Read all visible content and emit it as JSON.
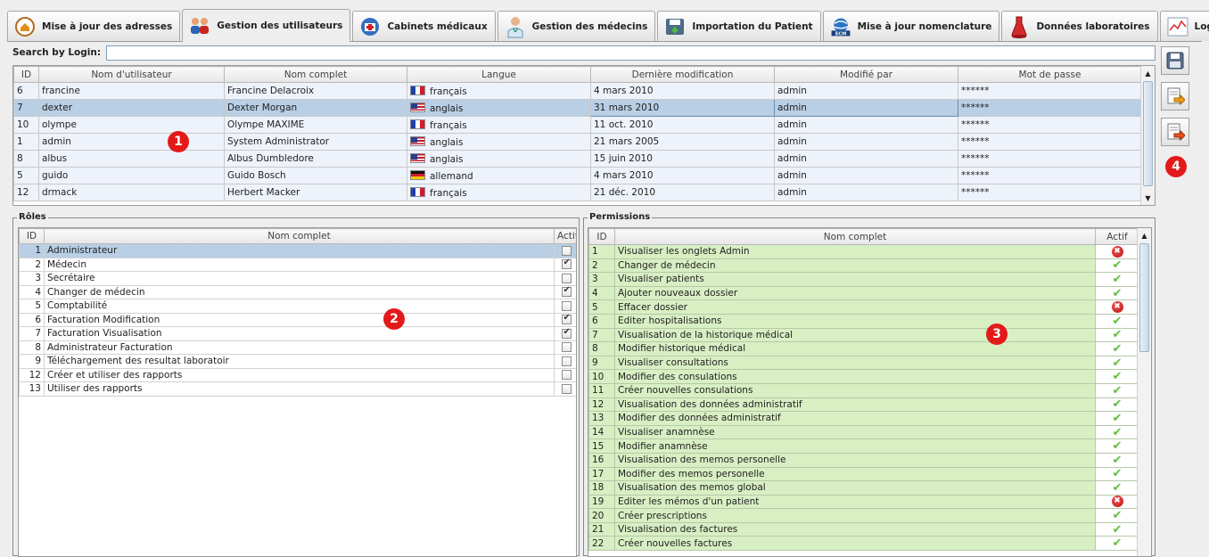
{
  "tabs": [
    {
      "name": "tab-mise-a-jour-adresses",
      "label": "Mise à jour des adresses",
      "icon": "address-book-icon",
      "active": false
    },
    {
      "name": "tab-gestion-utilisateurs",
      "label": "Gestion des utilisateurs",
      "icon": "users-icon",
      "active": true
    },
    {
      "name": "tab-cabinets-medicaux",
      "label": "Cabinets médicaux",
      "icon": "medical-kit-icon",
      "active": false
    },
    {
      "name": "tab-gestion-medecins",
      "label": "Gestion des médecins",
      "icon": "doctor-icon",
      "active": false
    },
    {
      "name": "tab-importation-patient",
      "label": "Importation du Patient",
      "icon": "import-icon",
      "active": false
    },
    {
      "name": "tab-mise-a-jour-nomenclature",
      "label": "Mise à jour nomenclature",
      "icon": "globe-icon",
      "active": false
    },
    {
      "name": "tab-donnees-laboratoires",
      "label": "Données laboratoires",
      "icon": "flask-icon",
      "active": false
    },
    {
      "name": "tab-log",
      "label": "Log",
      "icon": "chart-icon",
      "active": false
    }
  ],
  "search": {
    "label": "Search by Login:",
    "value": ""
  },
  "users": {
    "columns": [
      "ID",
      "Nom d'utilisateur",
      "Nom complet",
      "Langue",
      "Dernière modification",
      "Modifié par",
      "Mot de passe"
    ],
    "rows": [
      {
        "id": "6",
        "login": "francine",
        "full_name": "Francine Delacroix",
        "lang": "français",
        "flag": "fr",
        "modified": "4 mars 2010",
        "by": "admin",
        "pwd": "******",
        "selected": false
      },
      {
        "id": "7",
        "login": "dexter",
        "full_name": "Dexter Morgan",
        "lang": "anglais",
        "flag": "us",
        "modified": "31 mars 2010",
        "by": "admin",
        "pwd": "******",
        "selected": true
      },
      {
        "id": "10",
        "login": "olympe",
        "full_name": "Olympe MAXIME",
        "lang": "français",
        "flag": "fr",
        "modified": "11 oct. 2010",
        "by": "admin",
        "pwd": "******",
        "selected": false
      },
      {
        "id": "1",
        "login": "admin",
        "full_name": "System Administrator",
        "lang": "anglais",
        "flag": "us",
        "modified": "21 mars 2005",
        "by": "admin",
        "pwd": "******",
        "selected": false
      },
      {
        "id": "8",
        "login": "albus",
        "full_name": "Albus Dumbledore",
        "lang": "anglais",
        "flag": "us",
        "modified": "15 juin 2010",
        "by": "admin",
        "pwd": "******",
        "selected": false
      },
      {
        "id": "5",
        "login": "guido",
        "full_name": "Guido Bosch",
        "lang": "allemand",
        "flag": "de",
        "modified": "4 mars 2010",
        "by": "admin",
        "pwd": "******",
        "selected": false
      },
      {
        "id": "12",
        "login": "drmack",
        "full_name": "Herbert Macker",
        "lang": "français",
        "flag": "fr",
        "modified": "21 déc. 2010",
        "by": "admin",
        "pwd": "******",
        "selected": false
      }
    ]
  },
  "side_buttons": [
    {
      "name": "save-button",
      "icon": "floppy-disk-icon"
    },
    {
      "name": "add-user-button",
      "icon": "add-document-icon"
    },
    {
      "name": "delete-user-button",
      "icon": "remove-document-icon"
    }
  ],
  "roles": {
    "title": "Rôles",
    "columns": [
      "ID",
      "Nom complet",
      "Actif"
    ],
    "rows": [
      {
        "id": "1",
        "name": "Administrateur",
        "active": false,
        "selected": true
      },
      {
        "id": "2",
        "name": "Médecin",
        "active": true,
        "selected": false
      },
      {
        "id": "3",
        "name": "Secrétaire",
        "active": false,
        "selected": false
      },
      {
        "id": "4",
        "name": "Changer de médecin",
        "active": true,
        "selected": false
      },
      {
        "id": "5",
        "name": "Comptabilité",
        "active": false,
        "selected": false
      },
      {
        "id": "6",
        "name": "Facturation Modification",
        "active": true,
        "selected": false
      },
      {
        "id": "7",
        "name": "Facturation Visualisation",
        "active": true,
        "selected": false
      },
      {
        "id": "8",
        "name": "Administrateur Facturation",
        "active": false,
        "selected": false
      },
      {
        "id": "9",
        "name": "Téléchargement des resultat laboratoir",
        "active": false,
        "selected": false
      },
      {
        "id": "12",
        "name": "Créer et utiliser des rapports",
        "active": false,
        "selected": false
      },
      {
        "id": "13",
        "name": "Utiliser des rapports",
        "active": false,
        "selected": false
      }
    ]
  },
  "permissions": {
    "title": "Permissions",
    "columns": [
      "ID",
      "Nom complet",
      "Actif"
    ],
    "rows": [
      {
        "id": "1",
        "name": "Visualiser les onglets Admin",
        "active": false
      },
      {
        "id": "2",
        "name": "Changer de médecin",
        "active": true
      },
      {
        "id": "3",
        "name": "Visualiser patients",
        "active": true
      },
      {
        "id": "4",
        "name": "Ajouter nouveaux dossier",
        "active": true
      },
      {
        "id": "5",
        "name": "Effacer dossier",
        "active": false
      },
      {
        "id": "6",
        "name": "Editer hospitalisations",
        "active": true
      },
      {
        "id": "7",
        "name": "Visualisation de la historique médical",
        "active": true
      },
      {
        "id": "8",
        "name": "Modifier historique médical",
        "active": true
      },
      {
        "id": "9",
        "name": "Visualiser consultations",
        "active": true
      },
      {
        "id": "10",
        "name": "Modifier des consulations",
        "active": true
      },
      {
        "id": "11",
        "name": "Créer nouvelles consulations",
        "active": true
      },
      {
        "id": "12",
        "name": "Visualisation des données administratif",
        "active": true
      },
      {
        "id": "13",
        "name": "Modifier des données administratif",
        "active": true
      },
      {
        "id": "14",
        "name": "Visualiser anamnèse",
        "active": true
      },
      {
        "id": "15",
        "name": "Modifier anamnèse",
        "active": true
      },
      {
        "id": "16",
        "name": "Visualisation des memos personelle",
        "active": true
      },
      {
        "id": "17",
        "name": "Modifier des memos personelle",
        "active": true
      },
      {
        "id": "18",
        "name": "Visualisation des memos global",
        "active": true
      },
      {
        "id": "19",
        "name": "Editer les mémos d'un patient",
        "active": false
      },
      {
        "id": "20",
        "name": "Créer prescriptions",
        "active": true
      },
      {
        "id": "21",
        "name": "Visualisation des factures",
        "active": true
      },
      {
        "id": "22",
        "name": "Créer nouvelles factures",
        "active": true
      }
    ]
  },
  "callouts": [
    "1",
    "2",
    "3",
    "4"
  ],
  "colors": {
    "callout": "#e41a1a",
    "selected_row": "#b8cfe5",
    "permission_row": "#d8efc4",
    "ok": "#5fbf3a",
    "denied": "#c41414"
  }
}
